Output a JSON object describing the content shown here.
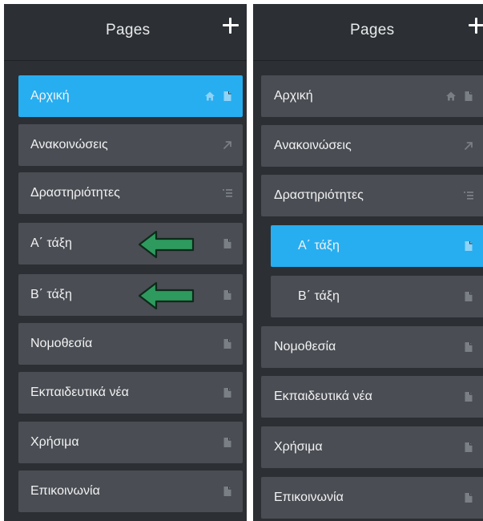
{
  "colors": {
    "panel_bg": "#2c2f33",
    "item_bg": "#4a4d53",
    "active_bg": "#27aef0",
    "text": "#f1f2f3",
    "icon": "#7a7e85",
    "arrow": "#2e9a5e"
  },
  "left_panel": {
    "title": "Pages",
    "add_icon": "plus-icon",
    "items": [
      {
        "label": "Αρχική",
        "icons": [
          "home-icon",
          "page-icon"
        ],
        "active": true
      },
      {
        "label": "Ανακοινώσεις",
        "icons": [
          "external-link-icon"
        ]
      },
      {
        "label": "Δραστηριότητες",
        "icons": [
          "list-icon"
        ]
      },
      {
        "label": "Α΄ τάξη",
        "icons": [
          "page-icon"
        ],
        "annotation": "green-arrow"
      },
      {
        "label": "Β΄ τάξη",
        "icons": [
          "page-icon"
        ],
        "annotation": "green-arrow"
      },
      {
        "label": "Νομοθεσία",
        "icons": [
          "page-icon"
        ]
      },
      {
        "label": "Εκπαιδευτικά νέα",
        "icons": [
          "page-icon"
        ]
      },
      {
        "label": "Χρήσιμα",
        "icons": [
          "page-icon"
        ]
      },
      {
        "label": "Επικοινωνία",
        "icons": [
          "page-icon"
        ]
      }
    ]
  },
  "right_panel": {
    "title": "Pages",
    "add_icon": "plus-icon",
    "items": [
      {
        "label": "Αρχική",
        "icons": [
          "home-icon",
          "page-icon"
        ]
      },
      {
        "label": "Ανακοινώσεις",
        "icons": [
          "external-link-icon"
        ]
      },
      {
        "label": "Δραστηριότητες",
        "icons": [
          "list-icon"
        ]
      },
      {
        "label": "Α΄ τάξη",
        "icons": [
          "page-icon"
        ],
        "child": true,
        "active": true
      },
      {
        "label": "Β΄ τάξη",
        "icons": [
          "page-icon"
        ],
        "child": true
      },
      {
        "label": "Νομοθεσία",
        "icons": [
          "page-icon"
        ]
      },
      {
        "label": "Εκπαιδευτικά νέα",
        "icons": [
          "page-icon"
        ]
      },
      {
        "label": "Χρήσιμα",
        "icons": [
          "page-icon"
        ]
      },
      {
        "label": "Επικοινωνία",
        "icons": [
          "page-icon"
        ]
      }
    ]
  }
}
